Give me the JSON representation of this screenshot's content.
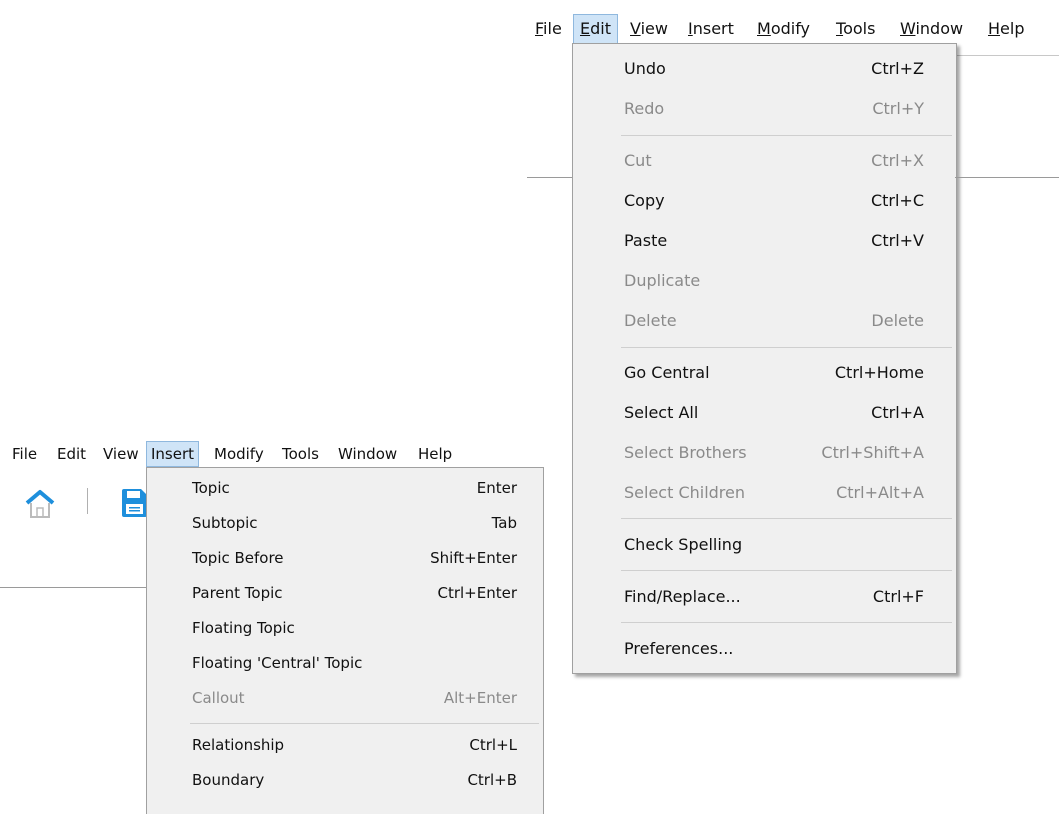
{
  "edit_window": {
    "menubar": [
      "File",
      "Edit",
      "View",
      "Insert",
      "Modify",
      "Tools",
      "Window",
      "Help"
    ],
    "open_menu": "Edit",
    "menu_items": [
      {
        "label": "Undo",
        "shortcut": "Ctrl+Z",
        "enabled": true
      },
      {
        "label": "Redo",
        "shortcut": "Ctrl+Y",
        "enabled": false
      },
      {
        "label": "Cut",
        "shortcut": "Ctrl+X",
        "enabled": false
      },
      {
        "label": "Copy",
        "shortcut": "Ctrl+C",
        "enabled": true
      },
      {
        "label": "Paste",
        "shortcut": "Ctrl+V",
        "enabled": true
      },
      {
        "label": "Duplicate",
        "shortcut": "",
        "enabled": false
      },
      {
        "label": "Delete",
        "shortcut": "Delete",
        "enabled": false
      },
      {
        "label": "Go Central",
        "shortcut": "Ctrl+Home",
        "enabled": true
      },
      {
        "label": "Select All",
        "shortcut": "Ctrl+A",
        "enabled": true
      },
      {
        "label": "Select Brothers",
        "shortcut": "Ctrl+Shift+A",
        "enabled": false
      },
      {
        "label": "Select Children",
        "shortcut": "Ctrl+Alt+A",
        "enabled": false
      },
      {
        "label": "Check Spelling",
        "shortcut": "",
        "enabled": true
      },
      {
        "label": "Find/Replace...",
        "shortcut": "Ctrl+F",
        "enabled": true
      },
      {
        "label": "Preferences...",
        "shortcut": "",
        "enabled": true
      }
    ]
  },
  "insert_window": {
    "menubar": [
      "File",
      "Edit",
      "View",
      "Insert",
      "Modify",
      "Tools",
      "Window",
      "Help"
    ],
    "open_menu": "Insert",
    "toolbar_icons": [
      "home-icon",
      "save-icon"
    ],
    "menu_items": [
      {
        "label": "Topic",
        "shortcut": "Enter",
        "enabled": true
      },
      {
        "label": "Subtopic",
        "shortcut": "Tab",
        "enabled": true
      },
      {
        "label": "Topic Before",
        "shortcut": "Shift+Enter",
        "enabled": true
      },
      {
        "label": "Parent Topic",
        "shortcut": "Ctrl+Enter",
        "enabled": true
      },
      {
        "label": "Floating Topic",
        "shortcut": "",
        "enabled": true
      },
      {
        "label": "Floating 'Central' Topic",
        "shortcut": "",
        "enabled": true
      },
      {
        "label": "Callout",
        "shortcut": "Alt+Enter",
        "enabled": false
      },
      {
        "label": "Relationship",
        "shortcut": "Ctrl+L",
        "enabled": true
      },
      {
        "label": "Boundary",
        "shortcut": "Ctrl+B",
        "enabled": true
      }
    ]
  },
  "colors": {
    "menu_bg": "#f0f0f0",
    "active_menu_bg": "#cfe4f7",
    "disabled_text": "#8a8a8a",
    "icon_blue": "#1e8fdc"
  }
}
